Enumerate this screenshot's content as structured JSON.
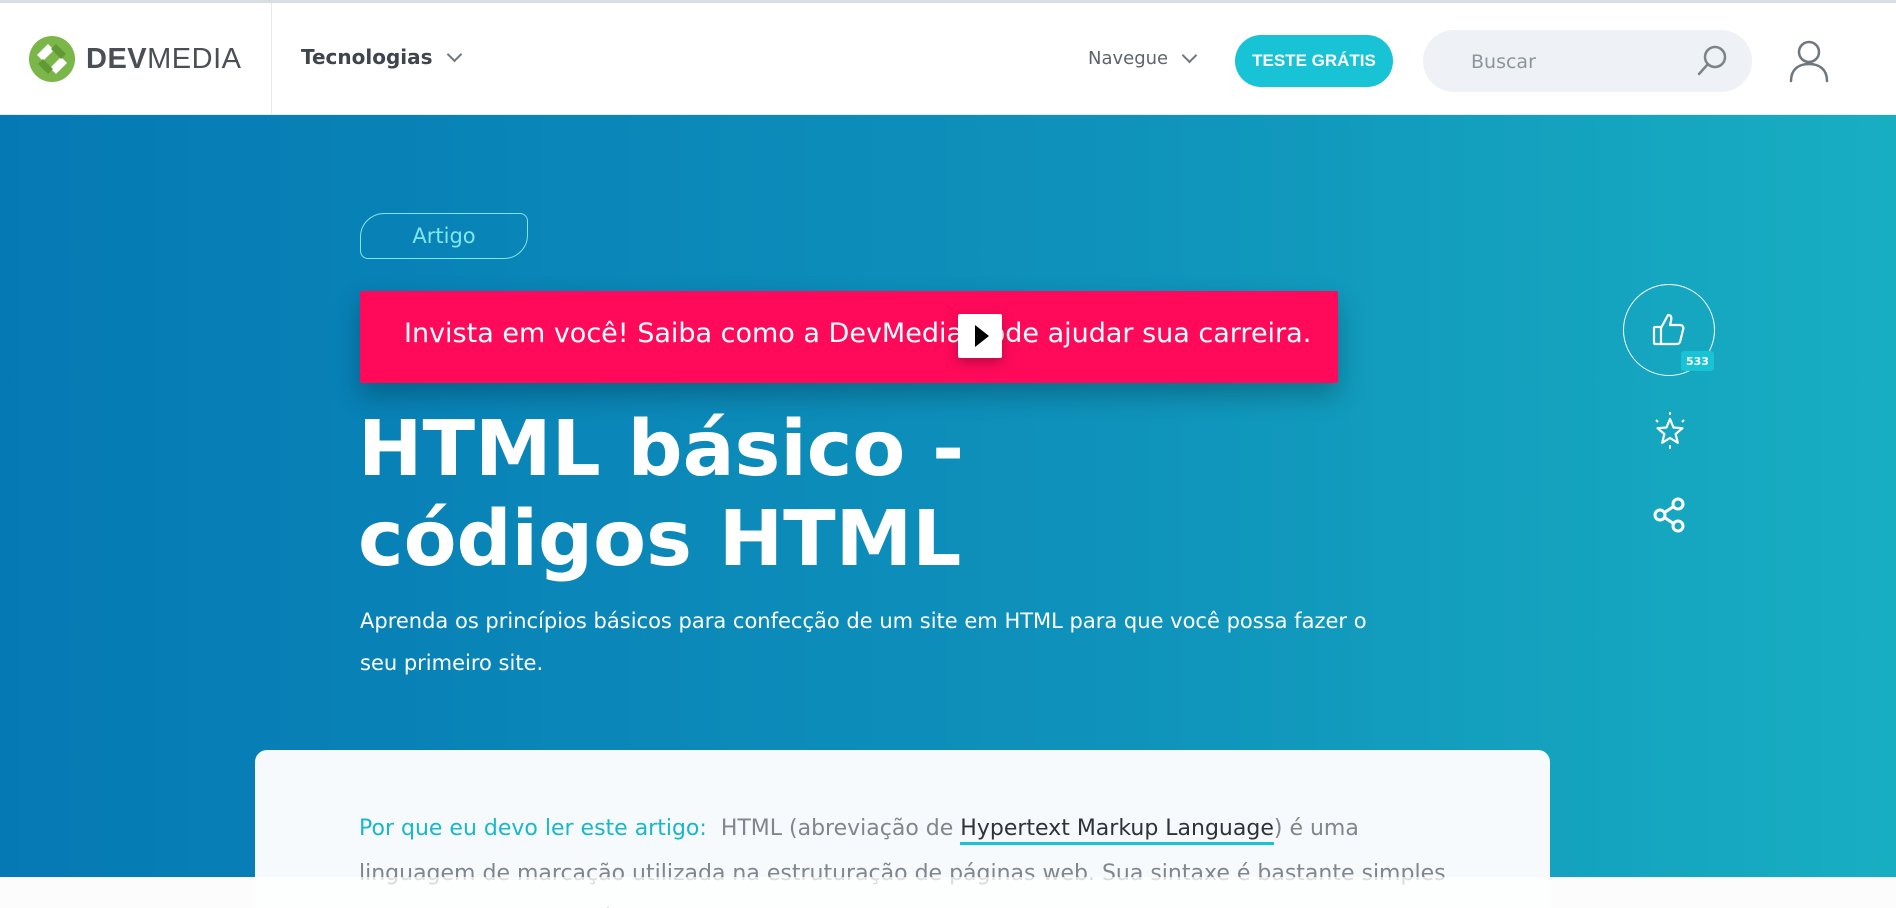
{
  "header": {
    "logo": {
      "part1": "DEV",
      "part2": "MEDIA"
    },
    "nav_tecnologias": "Tecnologias",
    "nav_navegue": "Navegue",
    "cta_label": "TESTE GRÁTIS",
    "search_placeholder": "Buscar",
    "icons": [
      "chevron-down-icon",
      "search-icon",
      "user-icon"
    ]
  },
  "hero": {
    "tag": "Artigo",
    "promo_text": "Invista em você! Saiba como a DevMedia pode ajudar sua carreira.",
    "title": "HTML básico - códigos HTML",
    "subtitle": "Aprenda os princípios básicos para confecção de um site em HTML para que você possa fazer o seu primeiro site.",
    "like_count": "533",
    "side_icons": [
      "thumbs-up-icon",
      "star-icon",
      "share-icon"
    ]
  },
  "article": {
    "lead_label": "Por que eu devo ler este artigo:",
    "intro_before": "HTML (abreviação de ",
    "term": "Hypertext Markup Language",
    "intro_after": ") é uma linguagem de marcação utilizada na estruturação de páginas web. Sua sintaxe é bastante simples e, assim como o XML é baseada em tags, que representam os diversos elementos de"
  },
  "colors": {
    "accent": "#17c3d4",
    "promo": "#ff0a5b",
    "hero_start": "#0579b4",
    "hero_end": "#18aec2",
    "logo_green": "#7ab648"
  }
}
